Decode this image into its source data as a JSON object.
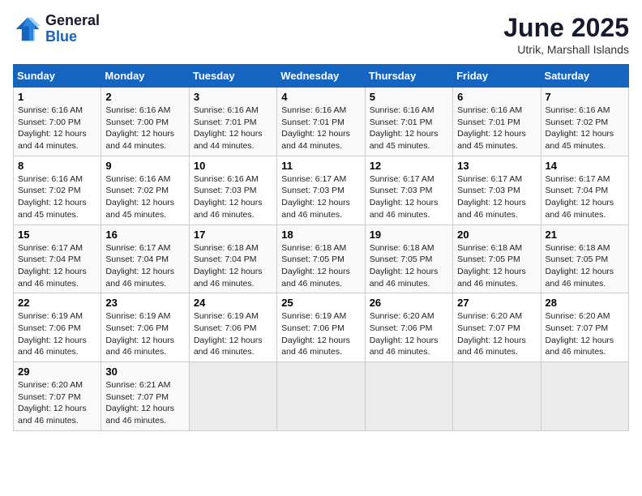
{
  "header": {
    "logo_general": "General",
    "logo_blue": "Blue",
    "month_year": "June 2025",
    "location": "Utrik, Marshall Islands"
  },
  "columns": [
    "Sunday",
    "Monday",
    "Tuesday",
    "Wednesday",
    "Thursday",
    "Friday",
    "Saturday"
  ],
  "weeks": [
    [
      {
        "day": "1",
        "info": "Sunrise: 6:16 AM\nSunset: 7:00 PM\nDaylight: 12 hours\nand 44 minutes."
      },
      {
        "day": "2",
        "info": "Sunrise: 6:16 AM\nSunset: 7:00 PM\nDaylight: 12 hours\nand 44 minutes."
      },
      {
        "day": "3",
        "info": "Sunrise: 6:16 AM\nSunset: 7:01 PM\nDaylight: 12 hours\nand 44 minutes."
      },
      {
        "day": "4",
        "info": "Sunrise: 6:16 AM\nSunset: 7:01 PM\nDaylight: 12 hours\nand 44 minutes."
      },
      {
        "day": "5",
        "info": "Sunrise: 6:16 AM\nSunset: 7:01 PM\nDaylight: 12 hours\nand 45 minutes."
      },
      {
        "day": "6",
        "info": "Sunrise: 6:16 AM\nSunset: 7:01 PM\nDaylight: 12 hours\nand 45 minutes."
      },
      {
        "day": "7",
        "info": "Sunrise: 6:16 AM\nSunset: 7:02 PM\nDaylight: 12 hours\nand 45 minutes."
      }
    ],
    [
      {
        "day": "8",
        "info": "Sunrise: 6:16 AM\nSunset: 7:02 PM\nDaylight: 12 hours\nand 45 minutes."
      },
      {
        "day": "9",
        "info": "Sunrise: 6:16 AM\nSunset: 7:02 PM\nDaylight: 12 hours\nand 45 minutes."
      },
      {
        "day": "10",
        "info": "Sunrise: 6:16 AM\nSunset: 7:03 PM\nDaylight: 12 hours\nand 46 minutes."
      },
      {
        "day": "11",
        "info": "Sunrise: 6:17 AM\nSunset: 7:03 PM\nDaylight: 12 hours\nand 46 minutes."
      },
      {
        "day": "12",
        "info": "Sunrise: 6:17 AM\nSunset: 7:03 PM\nDaylight: 12 hours\nand 46 minutes."
      },
      {
        "day": "13",
        "info": "Sunrise: 6:17 AM\nSunset: 7:03 PM\nDaylight: 12 hours\nand 46 minutes."
      },
      {
        "day": "14",
        "info": "Sunrise: 6:17 AM\nSunset: 7:04 PM\nDaylight: 12 hours\nand 46 minutes."
      }
    ],
    [
      {
        "day": "15",
        "info": "Sunrise: 6:17 AM\nSunset: 7:04 PM\nDaylight: 12 hours\nand 46 minutes."
      },
      {
        "day": "16",
        "info": "Sunrise: 6:17 AM\nSunset: 7:04 PM\nDaylight: 12 hours\nand 46 minutes."
      },
      {
        "day": "17",
        "info": "Sunrise: 6:18 AM\nSunset: 7:04 PM\nDaylight: 12 hours\nand 46 minutes."
      },
      {
        "day": "18",
        "info": "Sunrise: 6:18 AM\nSunset: 7:05 PM\nDaylight: 12 hours\nand 46 minutes."
      },
      {
        "day": "19",
        "info": "Sunrise: 6:18 AM\nSunset: 7:05 PM\nDaylight: 12 hours\nand 46 minutes."
      },
      {
        "day": "20",
        "info": "Sunrise: 6:18 AM\nSunset: 7:05 PM\nDaylight: 12 hours\nand 46 minutes."
      },
      {
        "day": "21",
        "info": "Sunrise: 6:18 AM\nSunset: 7:05 PM\nDaylight: 12 hours\nand 46 minutes."
      }
    ],
    [
      {
        "day": "22",
        "info": "Sunrise: 6:19 AM\nSunset: 7:06 PM\nDaylight: 12 hours\nand 46 minutes."
      },
      {
        "day": "23",
        "info": "Sunrise: 6:19 AM\nSunset: 7:06 PM\nDaylight: 12 hours\nand 46 minutes."
      },
      {
        "day": "24",
        "info": "Sunrise: 6:19 AM\nSunset: 7:06 PM\nDaylight: 12 hours\nand 46 minutes."
      },
      {
        "day": "25",
        "info": "Sunrise: 6:19 AM\nSunset: 7:06 PM\nDaylight: 12 hours\nand 46 minutes."
      },
      {
        "day": "26",
        "info": "Sunrise: 6:20 AM\nSunset: 7:06 PM\nDaylight: 12 hours\nand 46 minutes."
      },
      {
        "day": "27",
        "info": "Sunrise: 6:20 AM\nSunset: 7:07 PM\nDaylight: 12 hours\nand 46 minutes."
      },
      {
        "day": "28",
        "info": "Sunrise: 6:20 AM\nSunset: 7:07 PM\nDaylight: 12 hours\nand 46 minutes."
      }
    ],
    [
      {
        "day": "29",
        "info": "Sunrise: 6:20 AM\nSunset: 7:07 PM\nDaylight: 12 hours\nand 46 minutes."
      },
      {
        "day": "30",
        "info": "Sunrise: 6:21 AM\nSunset: 7:07 PM\nDaylight: 12 hours\nand 46 minutes."
      },
      {
        "day": "",
        "info": ""
      },
      {
        "day": "",
        "info": ""
      },
      {
        "day": "",
        "info": ""
      },
      {
        "day": "",
        "info": ""
      },
      {
        "day": "",
        "info": ""
      }
    ]
  ]
}
